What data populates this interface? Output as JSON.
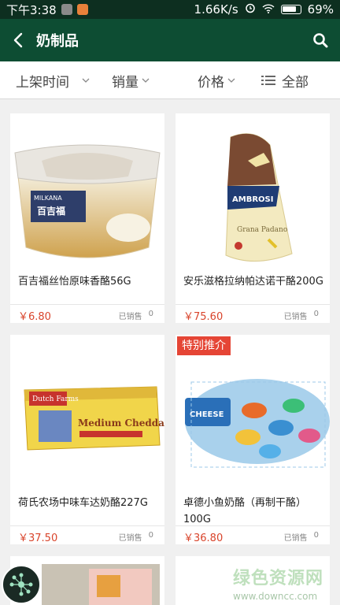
{
  "status_bar": {
    "time": "下午3:38",
    "speed": "1.66K/s",
    "battery": "69%"
  },
  "header": {
    "title": "奶制品"
  },
  "filters": [
    {
      "label": "上架时间"
    },
    {
      "label": "销量"
    },
    {
      "label": "价格"
    },
    {
      "label": "全部"
    }
  ],
  "products": [
    {
      "name": "百吉福丝怡原味香酪56G",
      "price": "￥6.80",
      "sold_label": "已销售",
      "sold_count": "0",
      "image_brand": "MILKANA",
      "image_caption": "百吉福",
      "image_icon": "cream-cheese-cup-image"
    },
    {
      "name": "安乐滋格拉纳帕达诺干酪200G",
      "price": "￥75.60",
      "sold_label": "已销售",
      "sold_count": "0",
      "image_brand": "AMBROSI",
      "image_caption": "Grana Padano",
      "image_icon": "parmesan-wedge-image"
    },
    {
      "name": "荷氏农场中味车达奶酪227G",
      "price": "￥37.50",
      "sold_label": "已销售",
      "sold_count": "0",
      "image_brand": "Dutch Farms",
      "image_caption": "Medium Cheddar",
      "image_icon": "cheddar-block-image"
    },
    {
      "name": "卓德小鱼奶酪（再制干酪）100G",
      "price": "￥36.80",
      "sold_label": "已销售",
      "sold_count": "0",
      "badge": "特别推介",
      "image_brand": "CHEESE",
      "image_caption": "",
      "image_icon": "fish-cheese-net-image"
    }
  ],
  "watermark": {
    "title": "绿色资源网",
    "url": "www.downcc.com"
  },
  "colors": {
    "status_bar": "#0d2f20",
    "app_bar": "#0d4d33",
    "price": "#d9442b",
    "badge": "#e54535"
  }
}
